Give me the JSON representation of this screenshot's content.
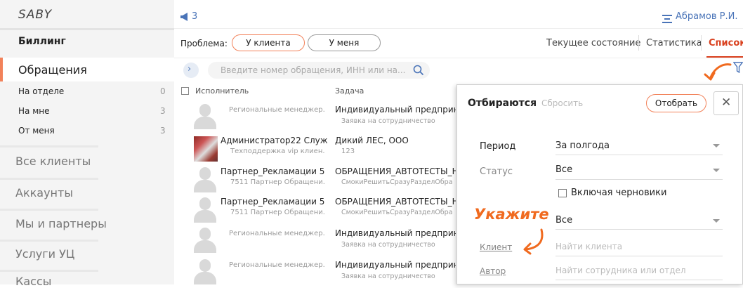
{
  "sidebar": {
    "logo": "SABY",
    "section": "Биллинг",
    "active": "Обращения",
    "subs": [
      {
        "label": "На отделе",
        "count": "0"
      },
      {
        "label": "На мне",
        "count": "3"
      },
      {
        "label": "От меня",
        "count": "3"
      }
    ],
    "nav": [
      "Все клиенты",
      "Аккаунты",
      "Мы и партнеры",
      "Услуги УЦ",
      "Кассы"
    ]
  },
  "header": {
    "notify_count": "3",
    "user": "Абрамов Р.И."
  },
  "toolbar": {
    "problem_label": "Проблема:",
    "pill_client": "У клиента",
    "pill_me": "У меня",
    "tabs": [
      "Текущее состояние",
      "Статистика",
      "Список"
    ]
  },
  "search": {
    "placeholder": "Введите номер обращения, ИНН или на..."
  },
  "table": {
    "col_executor": "Исполнитель",
    "col_task": "Задача",
    "rows": [
      {
        "name": "",
        "sub": "Региональные менеджер...",
        "task": "Индивидуальный предприним",
        "task_sub": "Заявка на сотрудничество"
      },
      {
        "name": "Администратор22 Служ...",
        "sub": "Техподдержка vip клиен...",
        "task": "Дикий ЛЕС, ООО",
        "task_sub": "123"
      },
      {
        "name": "Партнер_Рекламации 5",
        "sub": "7511 Партнер Обращени...",
        "task": "ОБРАЩЕНИЯ_АВТОТЕСТЫ_Н",
        "task_sub": "СмокиРешитьСразуРазделОбра"
      },
      {
        "name": "Партнер_Рекламации 5",
        "sub": "7511 Партнер Обращени...",
        "task": "ОБРАЩЕНИЯ_АВТОТЕСТЫ_Н",
        "task_sub": "СмокиРешитьСразуРазделОбра"
      },
      {
        "name": "",
        "sub": "Региональные менеджер...",
        "task": "Индивидуальный предприним",
        "task_sub": "Заявка на сотрудничество"
      },
      {
        "name": "",
        "sub": "Региональные менеджер...",
        "task": "Индивидуальный предприним",
        "task_sub": "Заявка на сотрудничество"
      }
    ]
  },
  "filter": {
    "title": "Отбираются",
    "reset": "Сбросить",
    "apply": "Отобрать",
    "period_label": "Период",
    "period_value": "За полгода",
    "status_label": "Статус",
    "status_value": "Все",
    "drafts_label": "Включая черновики",
    "third_value": "Все",
    "client_label": "Клиент",
    "client_placeholder": "Найти клиента",
    "author_label": "Автор",
    "author_placeholder": "Найти сотрудника или отдел"
  },
  "annotation": {
    "text": "Укажите"
  },
  "colors": {
    "accent": "#f2825a",
    "brand_red": "#d9401e",
    "link_blue": "#4a74b8",
    "handwriting": "#f06a1f"
  }
}
